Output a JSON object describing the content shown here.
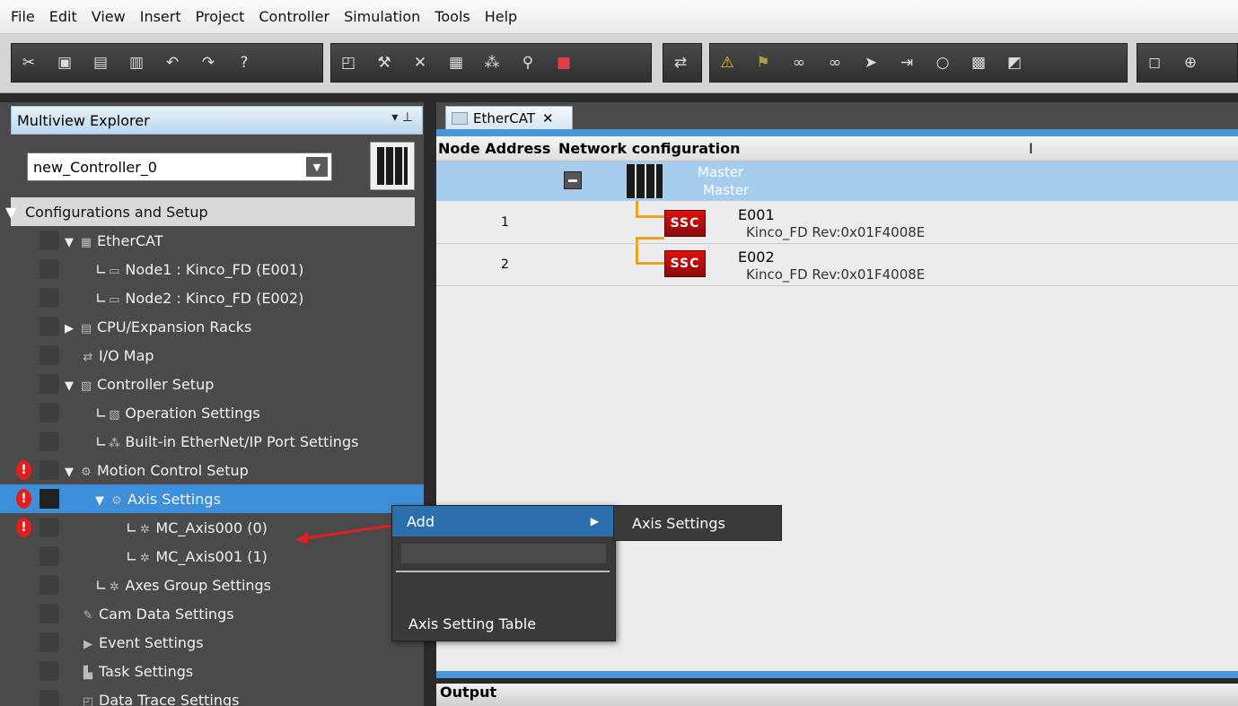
{
  "menubar": [
    "File",
    "Edit",
    "View",
    "Insert",
    "Project",
    "Controller",
    "Simulation",
    "Tools",
    "Help"
  ],
  "explorer": {
    "title": "Multiview Explorer",
    "pin_icon": "pin-icon",
    "controller": "new_Controller_0",
    "category": "Configurations and Setup",
    "tree": [
      {
        "label": "EtherCAT"
      },
      {
        "label": "Node1 : Kinco_FD (E001)"
      },
      {
        "label": "Node2 : Kinco_FD (E002)"
      },
      {
        "label": "CPU/Expansion Racks"
      },
      {
        "label": "I/O Map"
      },
      {
        "label": "Controller Setup"
      },
      {
        "label": "Operation Settings"
      },
      {
        "label": "Built-in EtherNet/IP Port Settings"
      },
      {
        "label": "Motion Control Setup"
      },
      {
        "label": "Axis Settings"
      },
      {
        "label": "MC_Axis000 (0)"
      },
      {
        "label": "MC_Axis001 (1)"
      },
      {
        "label": "Axes Group Settings"
      },
      {
        "label": "Cam Data Settings"
      },
      {
        "label": "Event Settings"
      },
      {
        "label": "Task Settings"
      },
      {
        "label": "Data Trace Settings"
      }
    ],
    "error_mark": "!"
  },
  "tab": {
    "label": "EtherCAT",
    "close": "✕"
  },
  "network": {
    "col_addr": "Node Address",
    "col_config": "Network configuration",
    "col_sep": "I",
    "master_title": "Master",
    "master_sub": "Master",
    "nodes": [
      {
        "addr": "1",
        "name": "E001",
        "desc": "Kinco_FD Rev:0x01F4008E",
        "badge": "SSC"
      },
      {
        "addr": "2",
        "name": "E002",
        "desc": "Kinco_FD Rev:0x01F4008E",
        "badge": "SSC"
      }
    ]
  },
  "context_menu": {
    "add": "Add",
    "axis_table": "Axis Setting Table",
    "submenu_axis_settings": "Axis Settings"
  },
  "output": {
    "label": "Output"
  },
  "colors": {
    "selection": "#3c8fd8",
    "accent_blue": "#4b96d8",
    "error": "#e02020"
  }
}
